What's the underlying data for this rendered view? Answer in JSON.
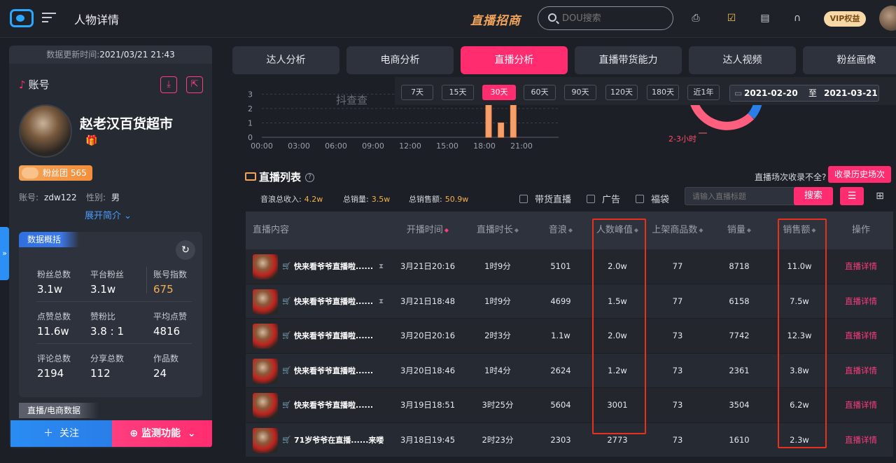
{
  "topbar": {
    "page_title": "人物详情",
    "brand": "直播招商",
    "search_placeholder": "DOU搜索",
    "vip_label": "VIP权益",
    "icons": [
      "printer-icon",
      "clipboard-check-icon",
      "document-icon",
      "headset-icon"
    ]
  },
  "sidebar": {
    "update_label": "数据更新时间:",
    "update_time": "2021/03/21 21:43",
    "account_heading": "账号",
    "nickname": "赵老汉百货超市",
    "fans_badge": "粉丝团 565",
    "account_label": "账号:",
    "account_id": "zdw122",
    "gender_label": "性别:",
    "gender": "男",
    "expand_label": "展开简介",
    "overview_tag": "数据概括",
    "stats": [
      {
        "label": "粉丝总数",
        "value": "3.1w"
      },
      {
        "label": "平台粉丝",
        "value": "3.1w"
      },
      {
        "label": "账号指数",
        "value": "675"
      },
      {
        "label": "点赞总数",
        "value": "11.6w"
      },
      {
        "label": "赞粉比",
        "value": "3.8 : 1"
      },
      {
        "label": "平均点赞",
        "value": "4816"
      },
      {
        "label": "评论总数",
        "value": "2194"
      },
      {
        "label": "分享总数",
        "value": "112"
      },
      {
        "label": "作品数",
        "value": "24"
      }
    ],
    "live_tag": "直播/电商数据",
    "follow_label": "关注",
    "monitor_label": "监测功能"
  },
  "tabs": [
    "达人分析",
    "电商分析",
    "直播分析",
    "直播带货能力",
    "达人视频",
    "粉丝画像"
  ],
  "active_tab": 2,
  "date_filter": {
    "options": [
      "7天",
      "15天",
      "30天",
      "60天",
      "90天",
      "120天",
      "180天",
      "近1年"
    ],
    "active": 2,
    "from": "2021-02-20",
    "sep": "至",
    "to": "2021-03-21"
  },
  "chart_data": {
    "type": "bar",
    "x_ticks": [
      "00:00",
      "03:00",
      "06:00",
      "09:00",
      "12:00",
      "15:00",
      "18:00",
      "21:00"
    ],
    "y_ticks": [
      "0",
      "1",
      "2",
      "3"
    ],
    "ylim": [
      0,
      3.6
    ],
    "bars": [
      {
        "hour": 18,
        "value": 2.6
      },
      {
        "hour": 19,
        "value": 1.0
      },
      {
        "hour": 20,
        "value": 2.6
      }
    ],
    "watermark": "抖查查",
    "donut_label": "2-3小时"
  },
  "live_list": {
    "title": "直播列表",
    "not_collected": "直播场次收录不全?",
    "history_button": "收录历史场次",
    "summary": [
      {
        "label": "音浪总收入:",
        "value": "4.2w"
      },
      {
        "label": "总销量:",
        "value": "3.5w"
      },
      {
        "label": "总销售额:",
        "value": "50.9w"
      }
    ],
    "filters": [
      "带货直播",
      "广告",
      "福袋"
    ],
    "search_placeholder": "请输入直播标题",
    "search_button": "搜索",
    "columns": [
      "直播内容",
      "开播时间",
      "直播时长",
      "音浪",
      "人数峰值",
      "上架商品数",
      "销量",
      "销售额",
      "操作"
    ],
    "rows": [
      {
        "title": "快来看爷爷直播啦......",
        "hourglass": true,
        "start": "3月21日20:16",
        "duration": "1时9分",
        "yinlang": "5101",
        "peak": "2.0w",
        "goods": "77",
        "sales": "8718",
        "amount": "11.0w",
        "action": "直播详情"
      },
      {
        "title": "快来看爷爷直播啦......",
        "hourglass": true,
        "start": "3月21日18:48",
        "duration": "1时9分",
        "yinlang": "4699",
        "peak": "1.5w",
        "goods": "77",
        "sales": "6158",
        "amount": "7.5w",
        "action": "直播详情"
      },
      {
        "title": "快来看爷爷直播啦......",
        "hourglass": false,
        "start": "3月20日20:16",
        "duration": "2时3分",
        "yinlang": "1.1w",
        "peak": "2.0w",
        "goods": "73",
        "sales": "7742",
        "amount": "12.3w",
        "action": "直播详情"
      },
      {
        "title": "快来看爷爷直播啦......",
        "hourglass": false,
        "start": "3月20日18:46",
        "duration": "1时4分",
        "yinlang": "2624",
        "peak": "1.2w",
        "goods": "73",
        "sales": "2361",
        "amount": "3.8w",
        "action": "直播详情"
      },
      {
        "title": "快来看爷爷直播啦......",
        "hourglass": false,
        "start": "3月19日18:51",
        "duration": "3时25分",
        "yinlang": "5604",
        "peak": "3001",
        "goods": "73",
        "sales": "3504",
        "amount": "6.2w",
        "action": "直播详情"
      },
      {
        "title": "71岁爷爷在直播......来喽",
        "hourglass": false,
        "start": "3月18日19:45",
        "duration": "2时23分",
        "yinlang": "2303",
        "peak": "2773",
        "goods": "73",
        "sales": "1610",
        "amount": "2.3w",
        "action": "直播详情"
      }
    ]
  },
  "colors": {
    "accent": "#ff2d6f",
    "blue": "#2a8cf2",
    "orange": "#f2a45a",
    "highlight": "#e8301f"
  }
}
